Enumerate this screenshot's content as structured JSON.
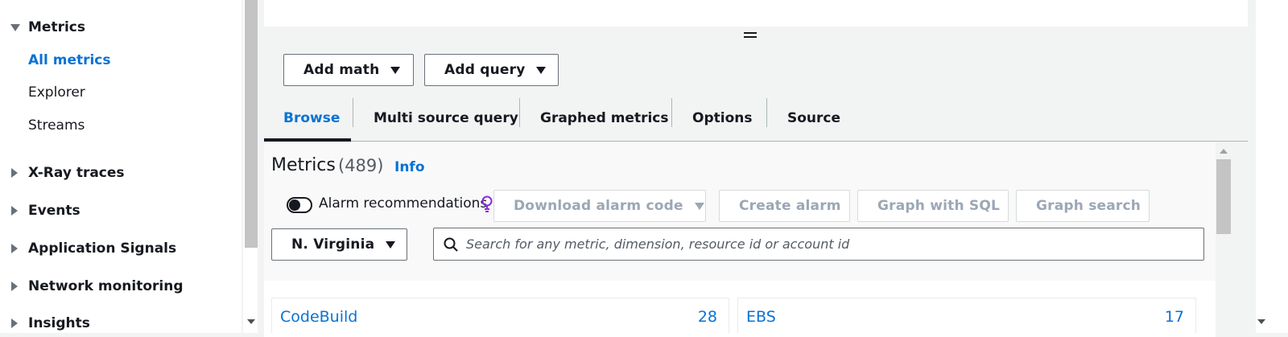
{
  "sidebar": {
    "metrics_section": {
      "label": "Metrics",
      "items": [
        {
          "label": "All metrics",
          "active": true
        },
        {
          "label": "Explorer"
        },
        {
          "label": "Streams"
        }
      ]
    },
    "sections": [
      {
        "label": "X-Ray traces"
      },
      {
        "label": "Events"
      },
      {
        "label": "Application Signals"
      },
      {
        "label": "Network monitoring"
      },
      {
        "label": "Insights"
      }
    ]
  },
  "toolbar": {
    "add_math": "Add math",
    "add_query": "Add query"
  },
  "tabs": [
    {
      "label": "Browse",
      "active": true
    },
    {
      "label": "Multi source query"
    },
    {
      "label": "Graphed metrics"
    },
    {
      "label": "Options"
    },
    {
      "label": "Source"
    }
  ],
  "metrics": {
    "title": "Metrics",
    "count": "(489)",
    "info": "Info",
    "alarm_recommendations": "Alarm recommendations",
    "download_alarm_code": "Download alarm code",
    "create_alarm": "Create alarm",
    "graph_with_sql": "Graph with SQL",
    "graph_search": "Graph search",
    "region": "N. Virginia",
    "search_placeholder": "Search for any metric, dimension, resource id or account id",
    "namespaces": [
      {
        "name": "CodeBuild",
        "count": "28"
      },
      {
        "name": "EBS",
        "count": "17"
      }
    ]
  },
  "colors": {
    "link": "#0972d3",
    "text": "#16191f",
    "disabled": "#9ba7b6",
    "bulb": "#8a2be2"
  }
}
